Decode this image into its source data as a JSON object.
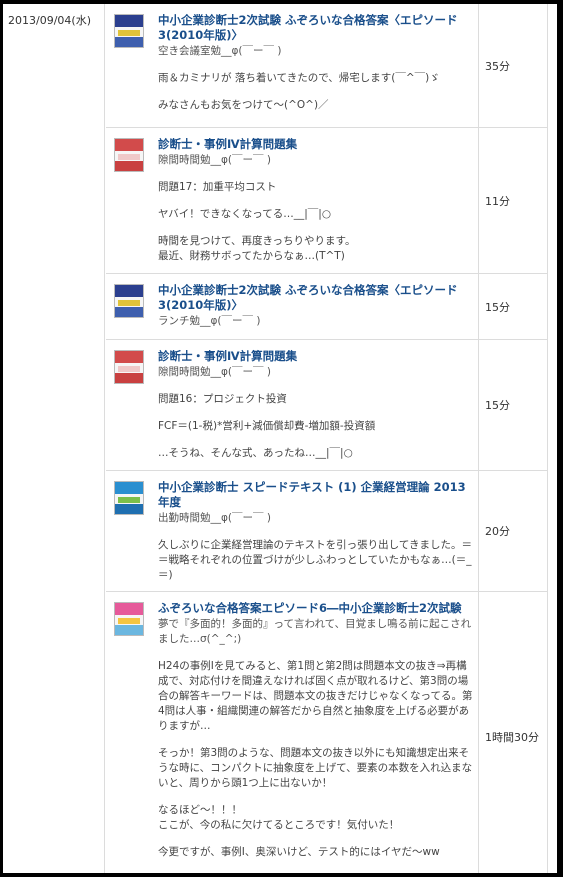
{
  "date": "2013/09/04(水)",
  "entries": [
    {
      "title": "中小企業診断士2次試験 ふぞろいな合格答案〈エピソード3(2010年版)〉",
      "place": "空き会議室勉__φ(￣ー￣ )",
      "paragraphs": [
        "雨＆カミナリが 落ち着いてきたので、帰宅します(￣^￣)ゞ",
        "みなさんもお気をつけて〜(^O^)／"
      ],
      "time": "35分",
      "book_colors": [
        "#2b3f8f",
        "#e0c33a",
        "#3e5fae"
      ]
    },
    {
      "title": "診断士・事例Ⅳ計算問題集",
      "place": "隙間時間勉__φ(￣ー￣ )",
      "paragraphs": [
        "問題17：加重平均コスト",
        "ヤバイ！できなくなってる…__|￣|○",
        "時間を見つけて、再度きっちりやります。\n最近、財務サボってたからなぁ…(T^T)"
      ],
      "time": "11分",
      "book_colors": [
        "#d24b4b",
        "#f0c9c9",
        "#c94040"
      ]
    },
    {
      "title": "中小企業診断士2次試験 ふぞろいな合格答案〈エピソード3(2010年版)〉",
      "place": "ランチ勉__φ(￣ー￣ )",
      "paragraphs": [],
      "time": "15分",
      "book_colors": [
        "#2b3f8f",
        "#e0c33a",
        "#3e5fae"
      ]
    },
    {
      "title": "診断士・事例Ⅳ計算問題集",
      "place": "隙間時間勉__φ(￣ー￣ )",
      "paragraphs": [
        "問題16：プロジェクト投資",
        "FCF＝(1-税)*営利+減価償却費-増加額-投資額",
        "…そうね、そんな式、あったね…__|￣|○"
      ],
      "time": "15分",
      "book_colors": [
        "#d24b4b",
        "#f0c9c9",
        "#c94040"
      ]
    },
    {
      "title": "中小企業診断士 スピードテキスト (1) 企業経営理論 2013年度",
      "place": "出勤時間勉__φ(￣ー￣ )",
      "paragraphs": [
        "久しぶりに企業経営理論のテキストを引っ張り出してきました。＝＝戦略それぞれの位置づけが少しふわっとしていたかもなぁ…(＝_＝)"
      ],
      "time": "20分",
      "book_colors": [
        "#2a8fd0",
        "#7cc04a",
        "#1f6fb0"
      ]
    },
    {
      "title": "ふぞろいな合格答案エピソード6―中小企業診断士2次試験",
      "place": "夢で『多面的！多面的』って言われて、目覚まし鳴る前に起こされました…σ(^_^;)",
      "paragraphs": [
        "H24の事例Ⅰを見てみると、第1問と第2問は問題本文の抜き⇒再構成で、対応付けを間違えなければ固く点が取れるけど、第3問の場合の解答キーワードは、問題本文の抜きだけじゃなくなってる。第4問は人事・組織関連の解答だから自然と抽象度を上げる必要がありますが…",
        "そっか！第3問のような、問題本文の抜き以外にも知識想定出来そうな時に、コンパクトに抽象度を上げて、要素の本数を入れ込まないと、周りから頭1つ上に出ないか！",
        "なるほど〜！！！\nここが、今の私に欠けてるところです！気付いた！",
        "今更ですが、事例Ⅰ、奥深いけど、テスト的にはイヤだ〜ww"
      ],
      "time": "1時間30分",
      "book_colors": [
        "#e65a9a",
        "#f4c542",
        "#6bb7e0"
      ]
    }
  ]
}
